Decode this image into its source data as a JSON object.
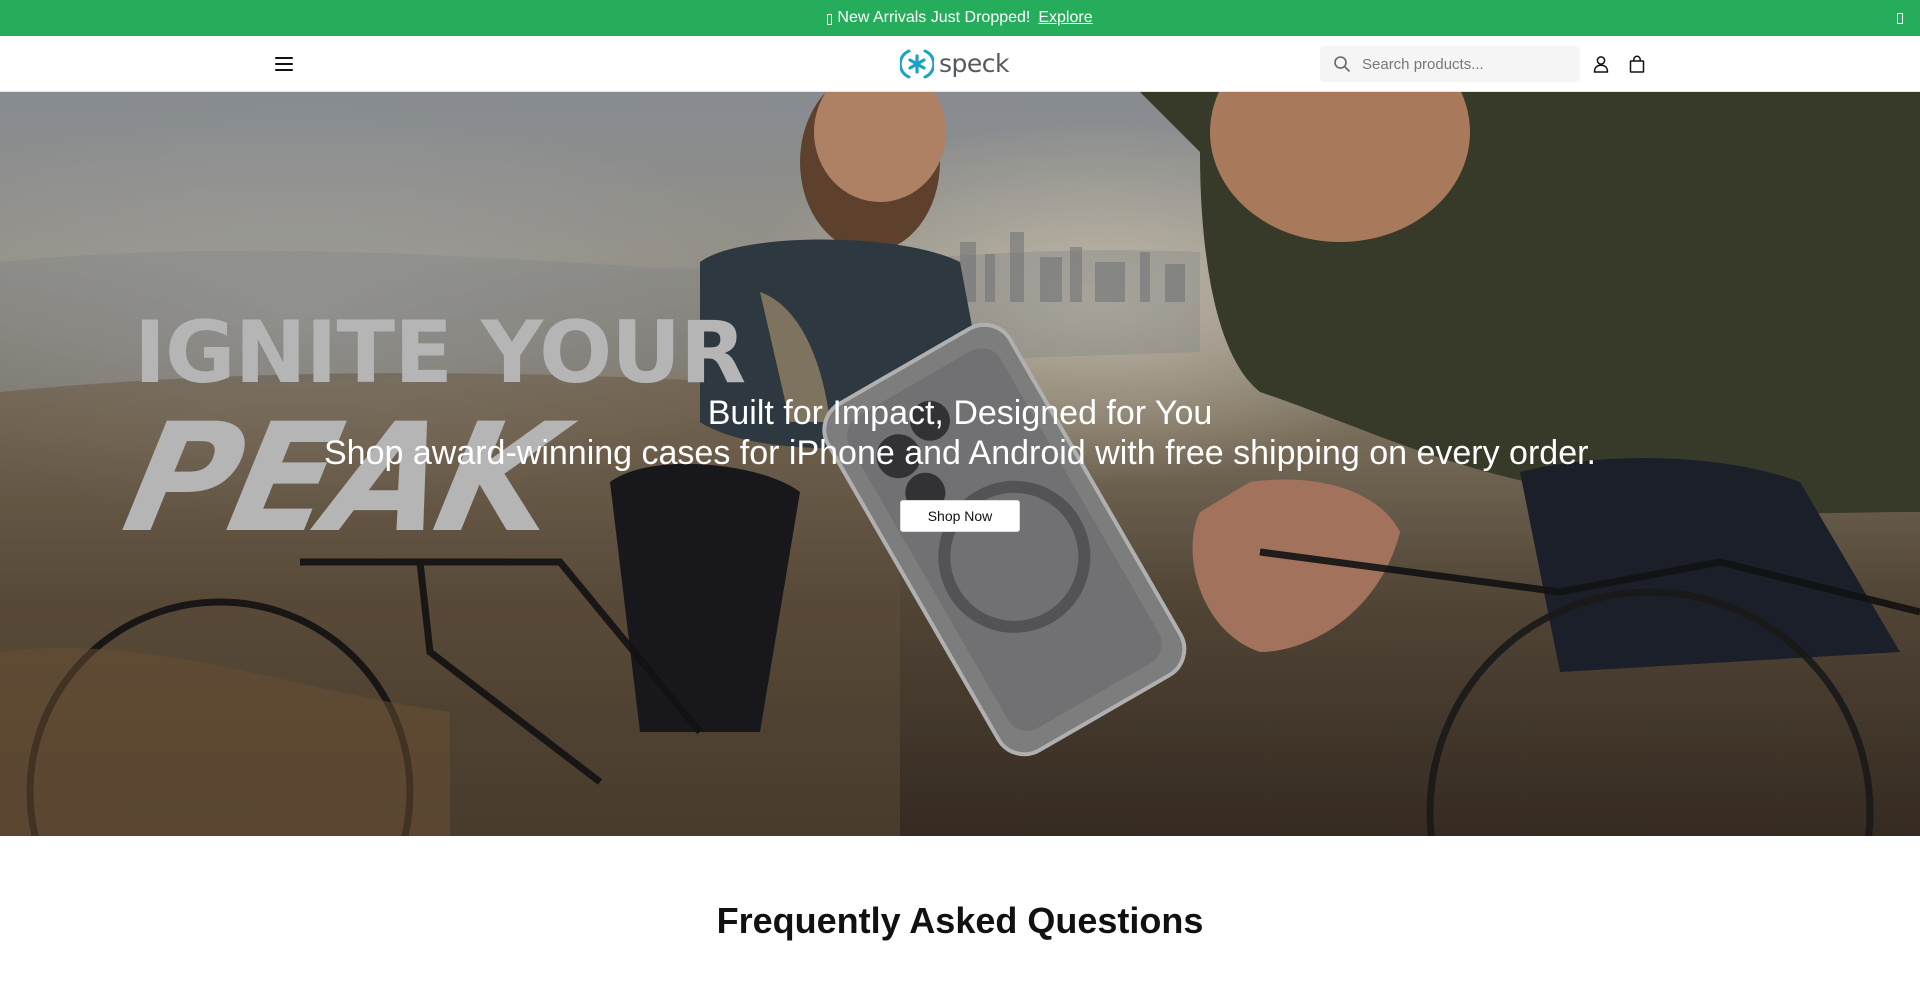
{
  "announcement": {
    "text": "New Arrivals Just Dropped!",
    "link_label": "Explore",
    "icon": "missing-glyph-box",
    "background_color": "#25ad5c"
  },
  "header": {
    "menu_icon": "hamburger-menu-icon",
    "logo_text": "speck",
    "logo_color": "#1aa3c2",
    "search": {
      "placeholder": "Search products...",
      "value": ""
    },
    "account_icon": "user-icon",
    "cart_icon": "shopping-bag-icon"
  },
  "hero": {
    "headline_line1": "IGNITE YOUR",
    "headline_line2": "PEAK",
    "title": "Built for Impact, Designed for You",
    "subtitle": "Shop award-winning cases for iPhone and Android with free shipping on every order.",
    "cta_label": "Shop Now"
  },
  "faq": {
    "title": "Frequently Asked Questions"
  }
}
